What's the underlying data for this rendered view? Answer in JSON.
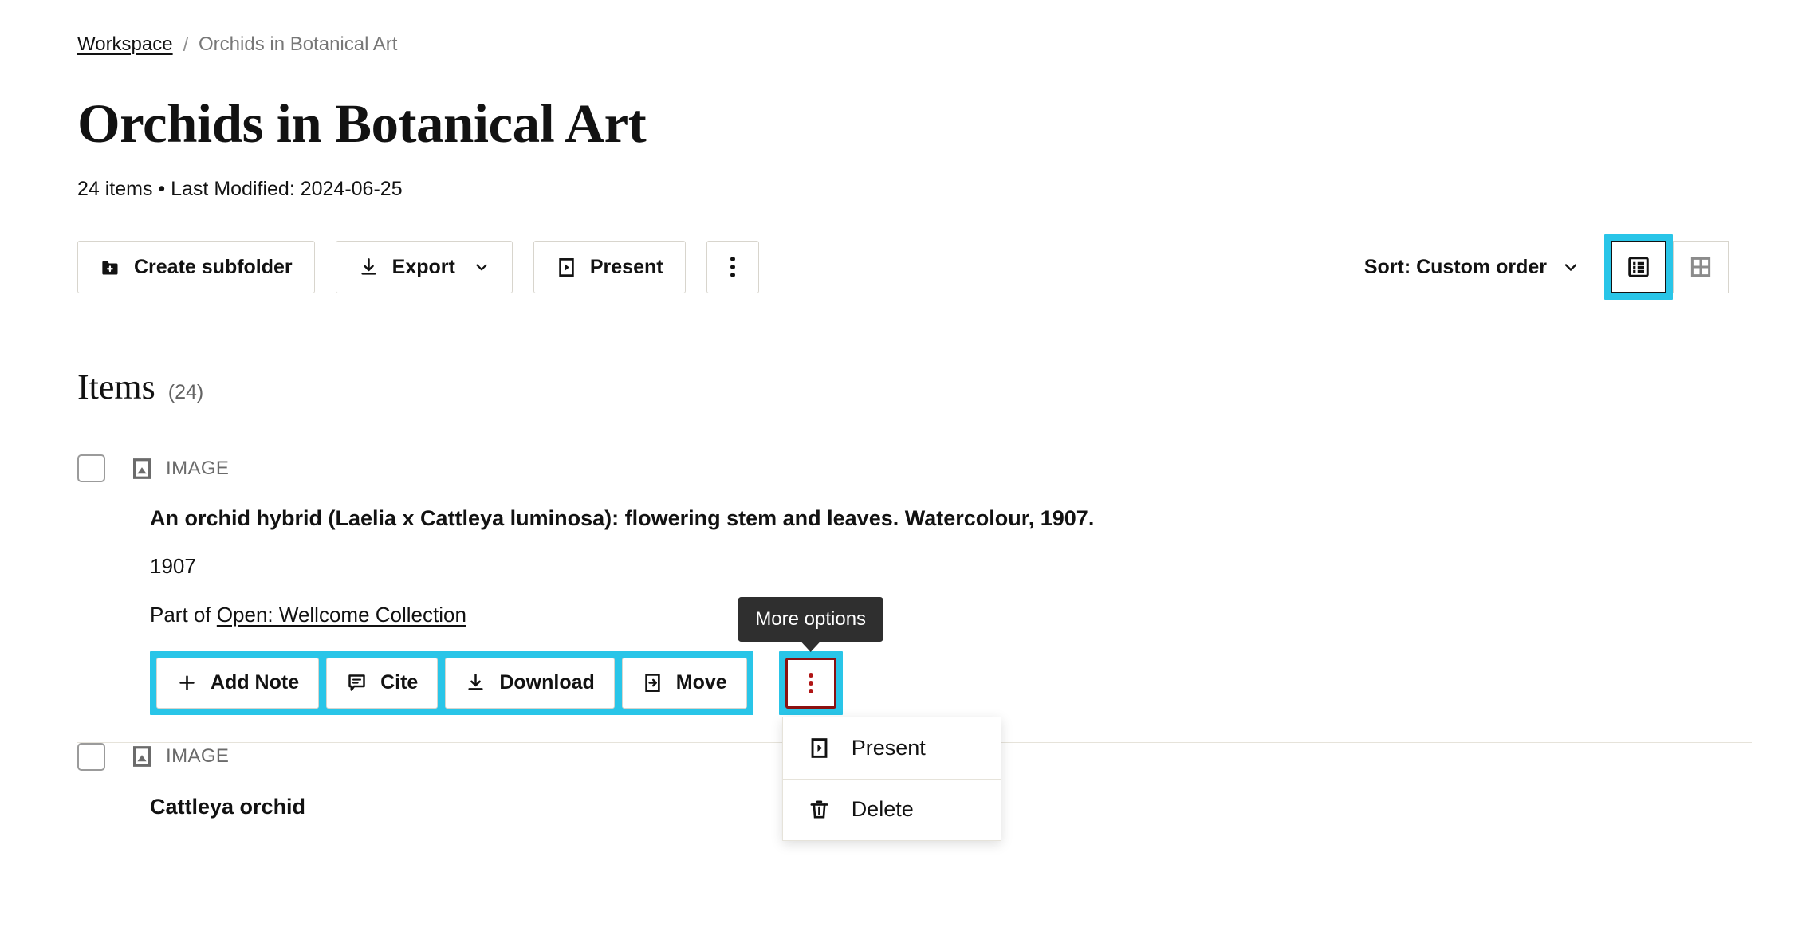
{
  "breadcrumb": {
    "root_label": "Workspace",
    "separator": "/",
    "current_label": "Orchids in Botanical Art"
  },
  "header": {
    "title": "Orchids in Botanical Art",
    "meta": "24 items • Last Modified: 2024-06-25"
  },
  "toolbar": {
    "create_subfolder_label": "Create subfolder",
    "export_label": "Export",
    "present_label": "Present",
    "more_options_label": "",
    "sort_label": "Sort: Custom order",
    "view_list_label": "",
    "view_grid_label": ""
  },
  "items_section": {
    "heading": "Items",
    "count": "(24)"
  },
  "items": [
    {
      "type": "IMAGE",
      "title": "An orchid hybrid (Laelia x Cattleya luminosa): flowering stem and leaves. Watercolour, 1907.",
      "date": "1907",
      "part_of_prefix": "Part of ",
      "part_of_link": "Open: Wellcome Collection",
      "actions": [
        {
          "label": "Add Note",
          "icon": "plus-icon"
        },
        {
          "label": "Cite",
          "icon": "quote-icon"
        },
        {
          "label": "Download",
          "icon": "download-icon"
        },
        {
          "label": "Move",
          "icon": "move-icon"
        }
      ]
    },
    {
      "type": "IMAGE",
      "title": "Cattleya orchid"
    }
  ],
  "tooltip": {
    "text": "More options"
  },
  "dropdown": {
    "items": [
      {
        "label": "Present",
        "icon": "present-icon"
      },
      {
        "label": "Delete",
        "icon": "trash-icon"
      }
    ]
  },
  "colors": {
    "highlight_cyan": "#29c5e8",
    "highlight_red": "#8b1111",
    "tooltip_bg": "#2f2f2f",
    "text": "#121212",
    "muted_text": "#6b6b6b",
    "border": "#d8d5cd"
  }
}
